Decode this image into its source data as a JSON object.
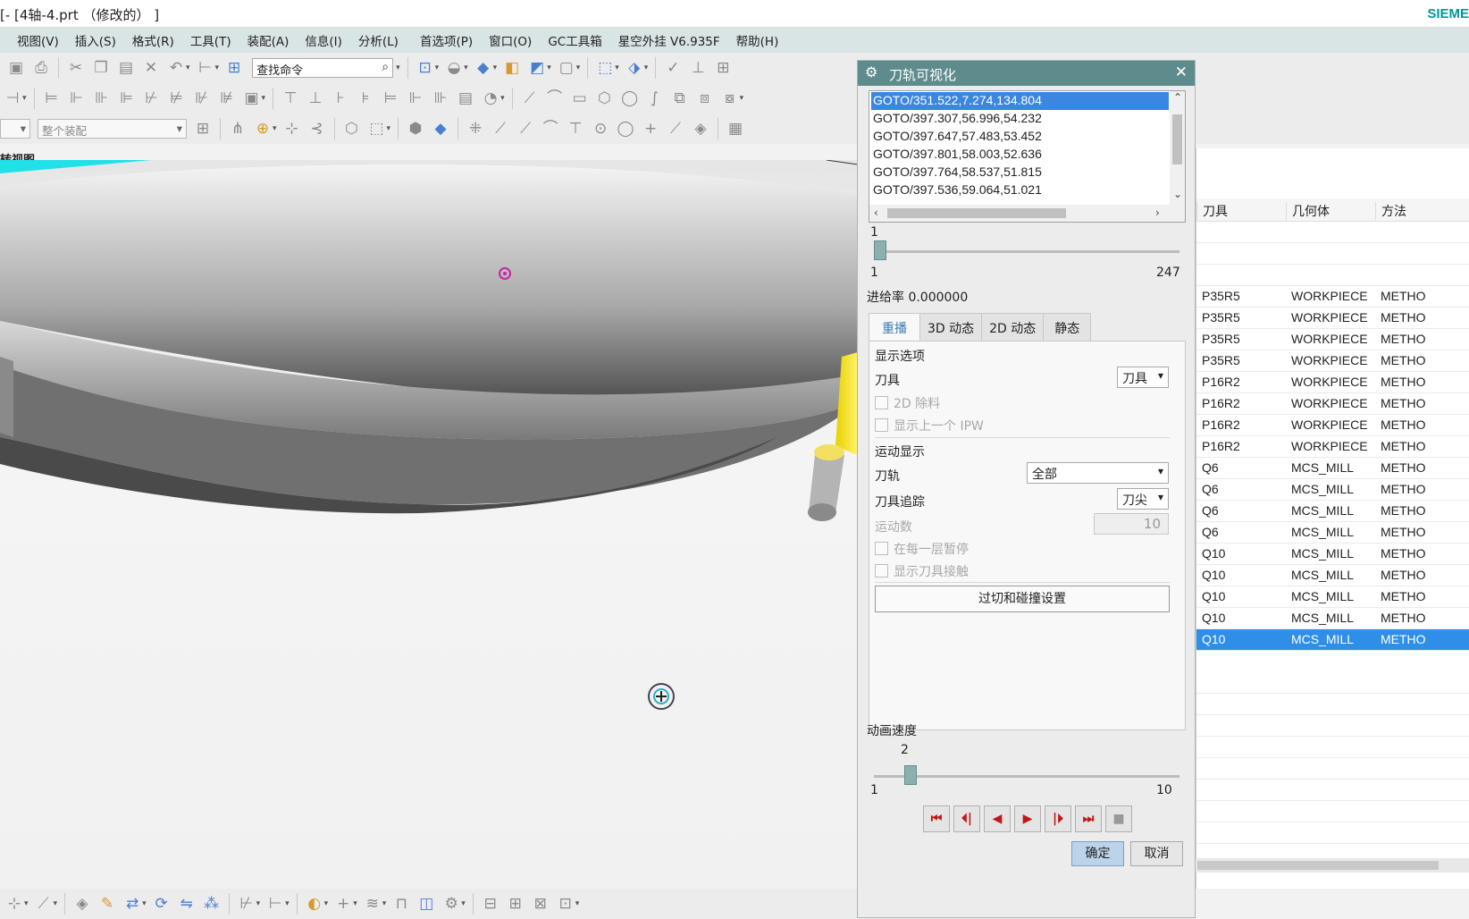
{
  "window": {
    "title": "[- [4轴-4.prt （修改的） ]",
    "brand": "SIEME"
  },
  "menu": [
    "视图(V)",
    "插入(S)",
    "格式(R)",
    "工具(T)",
    "装配(A)",
    "信息(I)",
    "分析(L)",
    "首选项(P)",
    "窗口(O)",
    "GC工具箱",
    "星空外挂 V6.935F",
    "帮助(H)"
  ],
  "toolbar": {
    "search_placeholder": "查找命令",
    "assembly_combo": "整个装配"
  },
  "viewport": {
    "title": "转视图"
  },
  "dialog": {
    "title": "刀轨可视化",
    "gotos": [
      "GOTO/351.522,7.274,134.804",
      "GOTO/397.307,56.996,54.232",
      "GOTO/397.647,57.483,53.452",
      "GOTO/397.801,58.003,52.636",
      "GOTO/397.764,58.537,51.815",
      "GOTO/397.536,59.064,51.021"
    ],
    "progress": {
      "current": "1",
      "min": "1",
      "max": "247"
    },
    "feed_rate": "进给率 0.000000",
    "tabs": [
      "重播",
      "3D 动态",
      "2D 动态",
      "静态"
    ],
    "display_options_label": "显示选项",
    "tool_label": "刀具",
    "tool_value": "刀具",
    "cb_2d_removal": "2D 除料",
    "cb_prev_ipw": "显示上一个 IPW",
    "motion_display_label": "运动显示",
    "path_label": "刀轨",
    "path_value": "全部",
    "tool_trace_label": "刀具追踪",
    "tool_trace_value": "刀尖",
    "motion_count_label": "运动数",
    "motion_count_value": "10",
    "cb_pause_each_level": "在每一层暂停",
    "cb_show_contact": "显示刀具接触",
    "gouge_button": "过切和碰撞设置",
    "anim_speed_label": "动画速度",
    "speed": {
      "current": "2",
      "min": "1",
      "max": "10"
    },
    "ok": "确定",
    "cancel": "取消"
  },
  "nav_table": {
    "headers": [
      "刀具",
      "几何体",
      "方法"
    ],
    "rows": [
      [
        "P35R5",
        "WORKPIECE",
        "METHO"
      ],
      [
        "P35R5",
        "WORKPIECE",
        "METHO"
      ],
      [
        "P35R5",
        "WORKPIECE",
        "METHO"
      ],
      [
        "P35R5",
        "WORKPIECE",
        "METHO"
      ],
      [
        "P16R2",
        "WORKPIECE",
        "METHO"
      ],
      [
        "P16R2",
        "WORKPIECE",
        "METHO"
      ],
      [
        "P16R2",
        "WORKPIECE",
        "METHO"
      ],
      [
        "P16R2",
        "WORKPIECE",
        "METHO"
      ],
      [
        "Q6",
        "MCS_MILL",
        "METHO"
      ],
      [
        "Q6",
        "MCS_MILL",
        "METHO"
      ],
      [
        "Q6",
        "MCS_MILL",
        "METHO"
      ],
      [
        "Q6",
        "MCS_MILL",
        "METHO"
      ],
      [
        "Q10",
        "MCS_MILL",
        "METHO"
      ],
      [
        "Q10",
        "MCS_MILL",
        "METHO"
      ],
      [
        "Q10",
        "MCS_MILL",
        "METHO"
      ],
      [
        "Q10",
        "MCS_MILL",
        "METHO"
      ],
      [
        "Q10",
        "MCS_MILL",
        "METHO"
      ]
    ]
  }
}
